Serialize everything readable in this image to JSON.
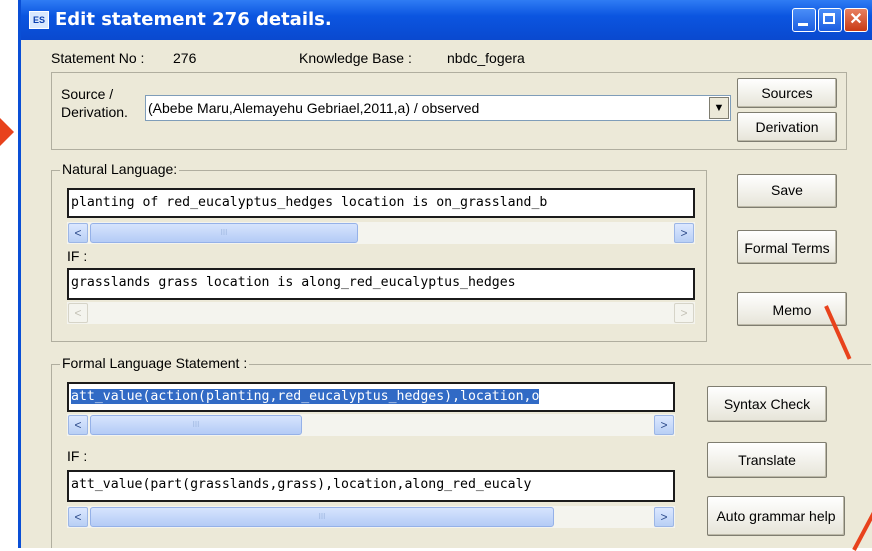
{
  "window": {
    "title": "Edit statement 276 details.",
    "close_glyph": "✕",
    "app_icon": "ES"
  },
  "header": {
    "statement_label": "Statement No :",
    "statement_value": "276",
    "kb_label": "Knowledge Base :",
    "kb_value": "nbdc_fogera"
  },
  "source": {
    "label_line1": "Source  /",
    "label_line2": "Derivation.",
    "value": "(Abebe Maru,Alemayehu Gebriael,2011,a) / observed",
    "dropdown_glyph": "▼"
  },
  "buttons": {
    "sources": "Sources",
    "derivation": "Derivation",
    "save": "Save",
    "formal_terms": "Formal Terms",
    "memo": "Memo",
    "syntax_check": "Syntax Check",
    "translate": "Translate",
    "auto_grammar": "Auto grammar help"
  },
  "natural_language": {
    "legend": "Natural Language:",
    "statement": "planting of red_eucalyptus_hedges location is on_grassland_b",
    "if_label": "IF :",
    "condition": "grasslands grass  location is along_red_eucalyptus_hedges"
  },
  "formal_language": {
    "legend": "Formal Language Statement :",
    "statement": "att_value(action(planting,red_eucalyptus_hedges),location,o",
    "if_label": "IF :",
    "condition": "att_value(part(grasslands,grass),location,along_red_eucaly"
  },
  "scroll": {
    "left": "<",
    "right": ">",
    "grip": "III"
  },
  "annotation_color": "#e8421c"
}
